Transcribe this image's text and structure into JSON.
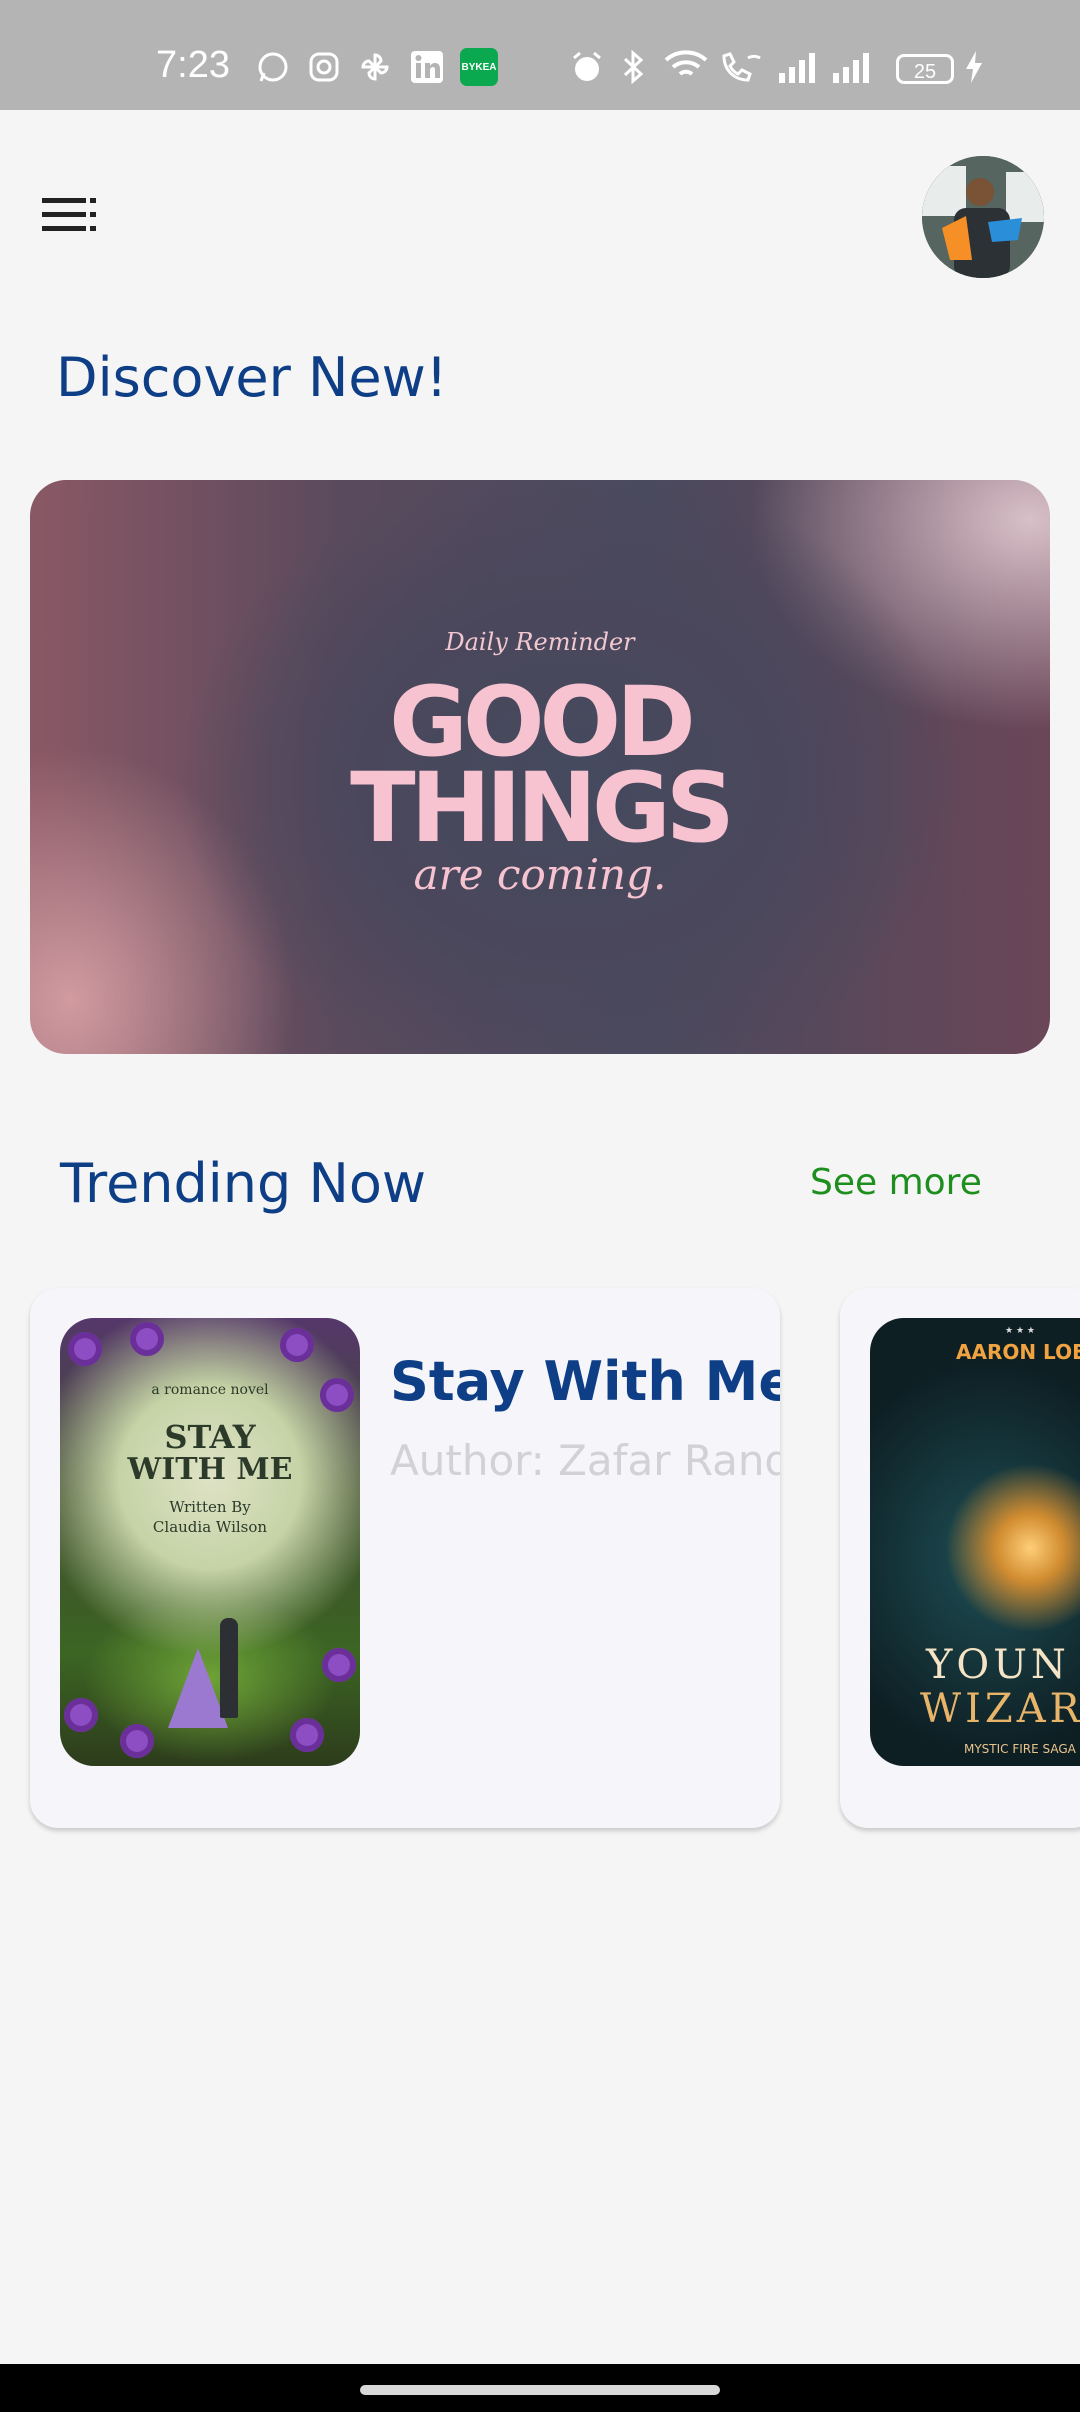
{
  "status_bar": {
    "time": "7:23",
    "battery": "25",
    "icons": [
      "whatsapp-icon",
      "instagram-icon",
      "pinwheel-icon",
      "linkedin-icon",
      "bykea-icon",
      "alarm-icon",
      "bluetooth-icon",
      "wifi-icon",
      "wifi-call-icon",
      "signal-icon",
      "signal-icon",
      "charging-icon"
    ],
    "bykea_label": "BYKEA"
  },
  "header": {
    "menu_icon": "menu-icon",
    "avatar": "profile-avatar"
  },
  "discover": {
    "title": "Discover New!",
    "banner": {
      "kicker": "Daily Reminder",
      "line1": "GOOD",
      "line2": "THINGS",
      "line3": "are coming."
    }
  },
  "trending": {
    "title": "Trending Now",
    "see_more": "See more",
    "books": [
      {
        "title": "Stay With Me, I",
        "author": "Author: Zafar Rand",
        "cover": {
          "kicker": "a romance novel",
          "title_l1": "STAY",
          "title_l2": "WITH ME",
          "written_by": "Written By",
          "author": "Claudia Wilson"
        }
      },
      {
        "title": "",
        "author": "",
        "cover": {
          "top": "AARON LOEB",
          "line1": "YOUN",
          "line2": "WIZAR",
          "series": "MYSTIC FIRE SAGA"
        }
      }
    ]
  },
  "colors": {
    "title_blue": "#0d3e86",
    "see_more_green": "#1e8f1e",
    "background": "#f5f5f5"
  }
}
